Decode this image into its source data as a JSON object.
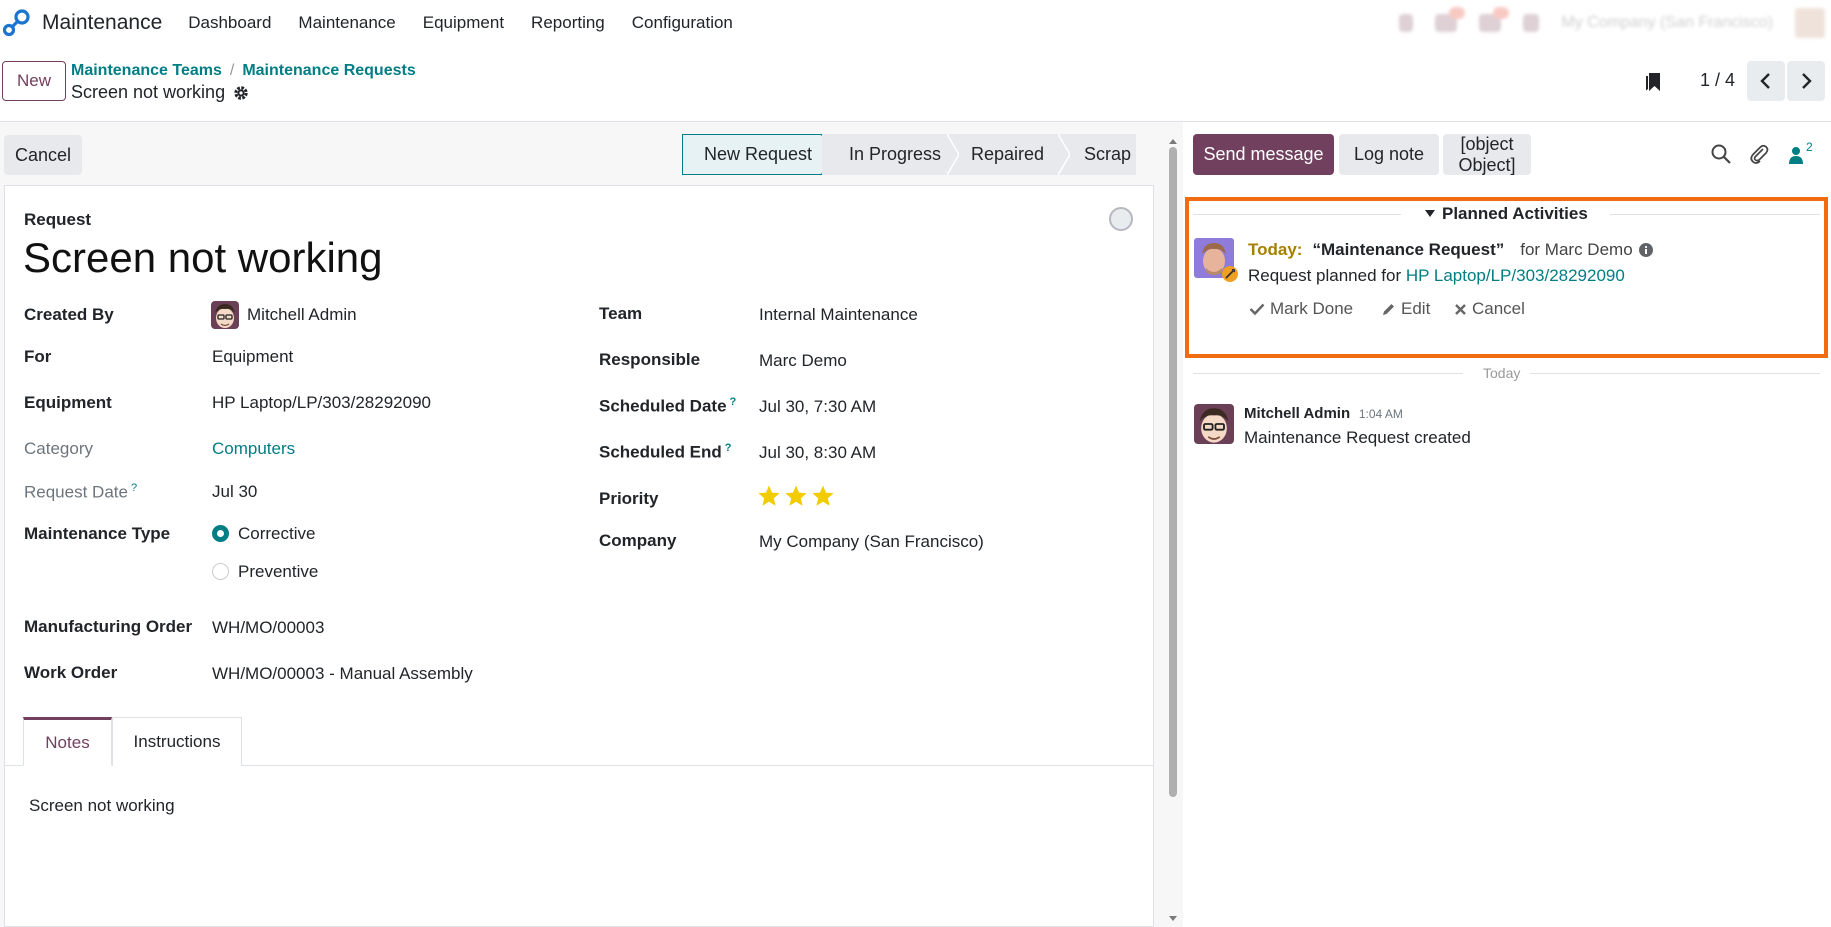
{
  "app": {
    "name": "Maintenance"
  },
  "menu": [
    "Dashboard",
    "Maintenance",
    "Equipment",
    "Reporting",
    "Configuration"
  ],
  "systray": {
    "company": "My Company (San Francisco)"
  },
  "control": {
    "new_label": "New",
    "breadcrumbs": [
      "Maintenance Teams",
      "Maintenance Requests"
    ],
    "breadcrumb_sep": "/",
    "record_title": "Screen not working",
    "pager": "1 / 4"
  },
  "form": {
    "cancel_label": "Cancel",
    "stages": [
      "New Request",
      "In Progress",
      "Repaired",
      "Scrap"
    ],
    "request_label": "Request",
    "title": "Screen not working",
    "left": {
      "created_by_label": "Created By",
      "created_by": "Mitchell Admin",
      "for_label": "For",
      "for_value": "Equipment",
      "equipment_label": "Equipment",
      "equipment": "HP Laptop/LP/303/28292090",
      "category_label": "Category",
      "category": "Computers",
      "request_date_label": "Request Date",
      "request_date": "Jul 30",
      "maint_type_label": "Maintenance Type",
      "type_corrective": "Corrective",
      "type_preventive": "Preventive",
      "mo_label": "Manufacturing Order",
      "mo": "WH/MO/00003",
      "wo_label": "Work Order",
      "wo": "WH/MO/00003 - Manual Assembly"
    },
    "right": {
      "team_label": "Team",
      "team": "Internal Maintenance",
      "responsible_label": "Responsible",
      "responsible": "Marc Demo",
      "sched_date_label": "Scheduled Date",
      "sched_date": "Jul 30, 7:30 AM",
      "sched_end_label": "Scheduled End",
      "sched_end": "Jul 30, 8:30 AM",
      "priority_label": "Priority",
      "priority_stars": 3,
      "company_label": "Company",
      "company": "My Company (San Francisco)"
    },
    "help_mark": "?",
    "tabs": [
      "Notes",
      "Instructions"
    ],
    "notes": "Screen not working"
  },
  "chatter": {
    "send_message": "Send message",
    "log_note": "Log note",
    "activity": {
      "due": "Today:",
      "name": "“Maintenance Request”",
      "for_text": "for Marc Demo",
      "desc_prefix": "Request planned for",
      "desc_link": "HP Laptop/LP/303/28292090",
      "mark_done": "Mark Done",
      "edit": "Edit",
      "cancel": "Cancel"
    },
    "followers_count": "2",
    "planned_title": "Planned Activities",
    "day_separator": "Today",
    "message": {
      "author": "Mitchell Admin",
      "time": "1:04 AM",
      "body": "Maintenance Request created"
    }
  },
  "colors": {
    "brand": "#71405e",
    "link": "#017e84",
    "highlight": "#f06b12",
    "star": "#f3cc00"
  }
}
